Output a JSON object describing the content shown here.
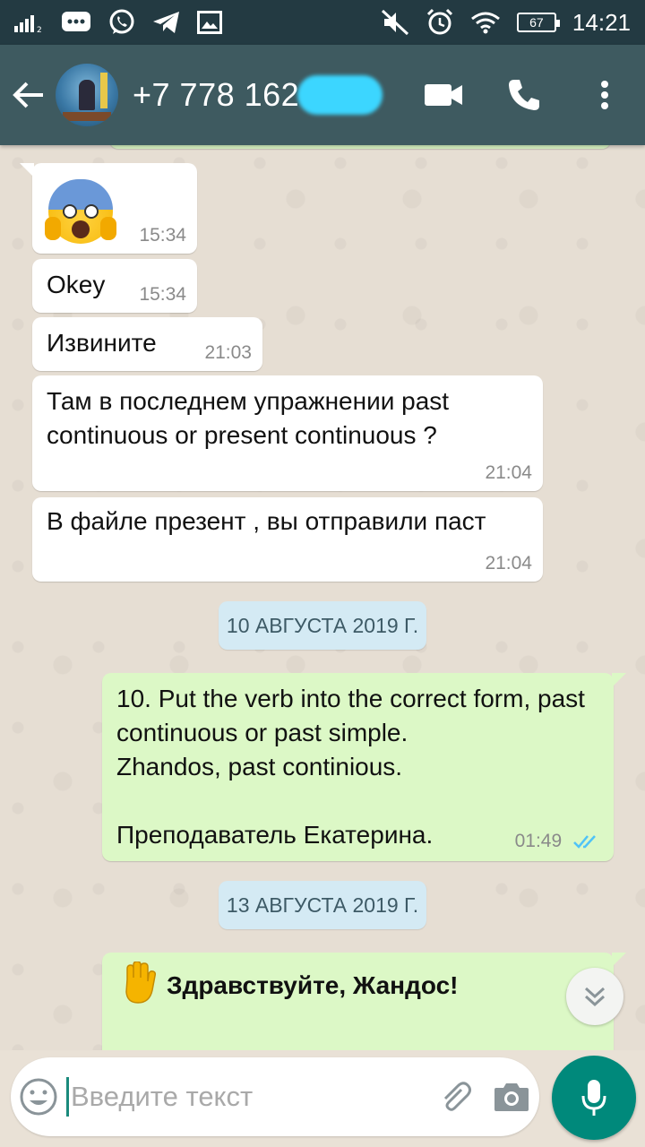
{
  "status_bar": {
    "time": "14:21",
    "battery": "67"
  },
  "header": {
    "contact_name": "+7 778 162"
  },
  "messages": [
    {
      "type": "in",
      "text": "",
      "emoji": "screaming-face",
      "time": "15:34"
    },
    {
      "type": "in",
      "text": "Okey",
      "time": "15:34"
    },
    {
      "type": "in",
      "text": "Извините",
      "time": "21:03"
    },
    {
      "type": "in",
      "text": "Там в последнем упражнении past continuous or present continuous ?",
      "time": "21:04"
    },
    {
      "type": "in",
      "text": "В файле презент , вы отправили паст",
      "time": "21:04"
    },
    {
      "type": "date",
      "text": "10 АВГУСТА 2019 Г."
    },
    {
      "type": "out",
      "text": "10. Put the verb into the correct form, past continuous or past simple.\nZhandos, past continious.\n\nПреподаватель Екатерина.",
      "time": "01:49",
      "status": "read"
    },
    {
      "type": "date",
      "text": "13 АВГУСТА 2019 Г."
    },
    {
      "type": "out",
      "text": "Здравствуйте, Жандос!",
      "emoji": "raised-hand"
    }
  ],
  "input": {
    "placeholder": "Введите текст"
  },
  "colors": {
    "header": "#3e5a60",
    "status_bar": "#233a42",
    "outgoing_bubble": "#dcf8c6",
    "accent": "#00897b",
    "read_ticks": "#4fc3f7"
  }
}
